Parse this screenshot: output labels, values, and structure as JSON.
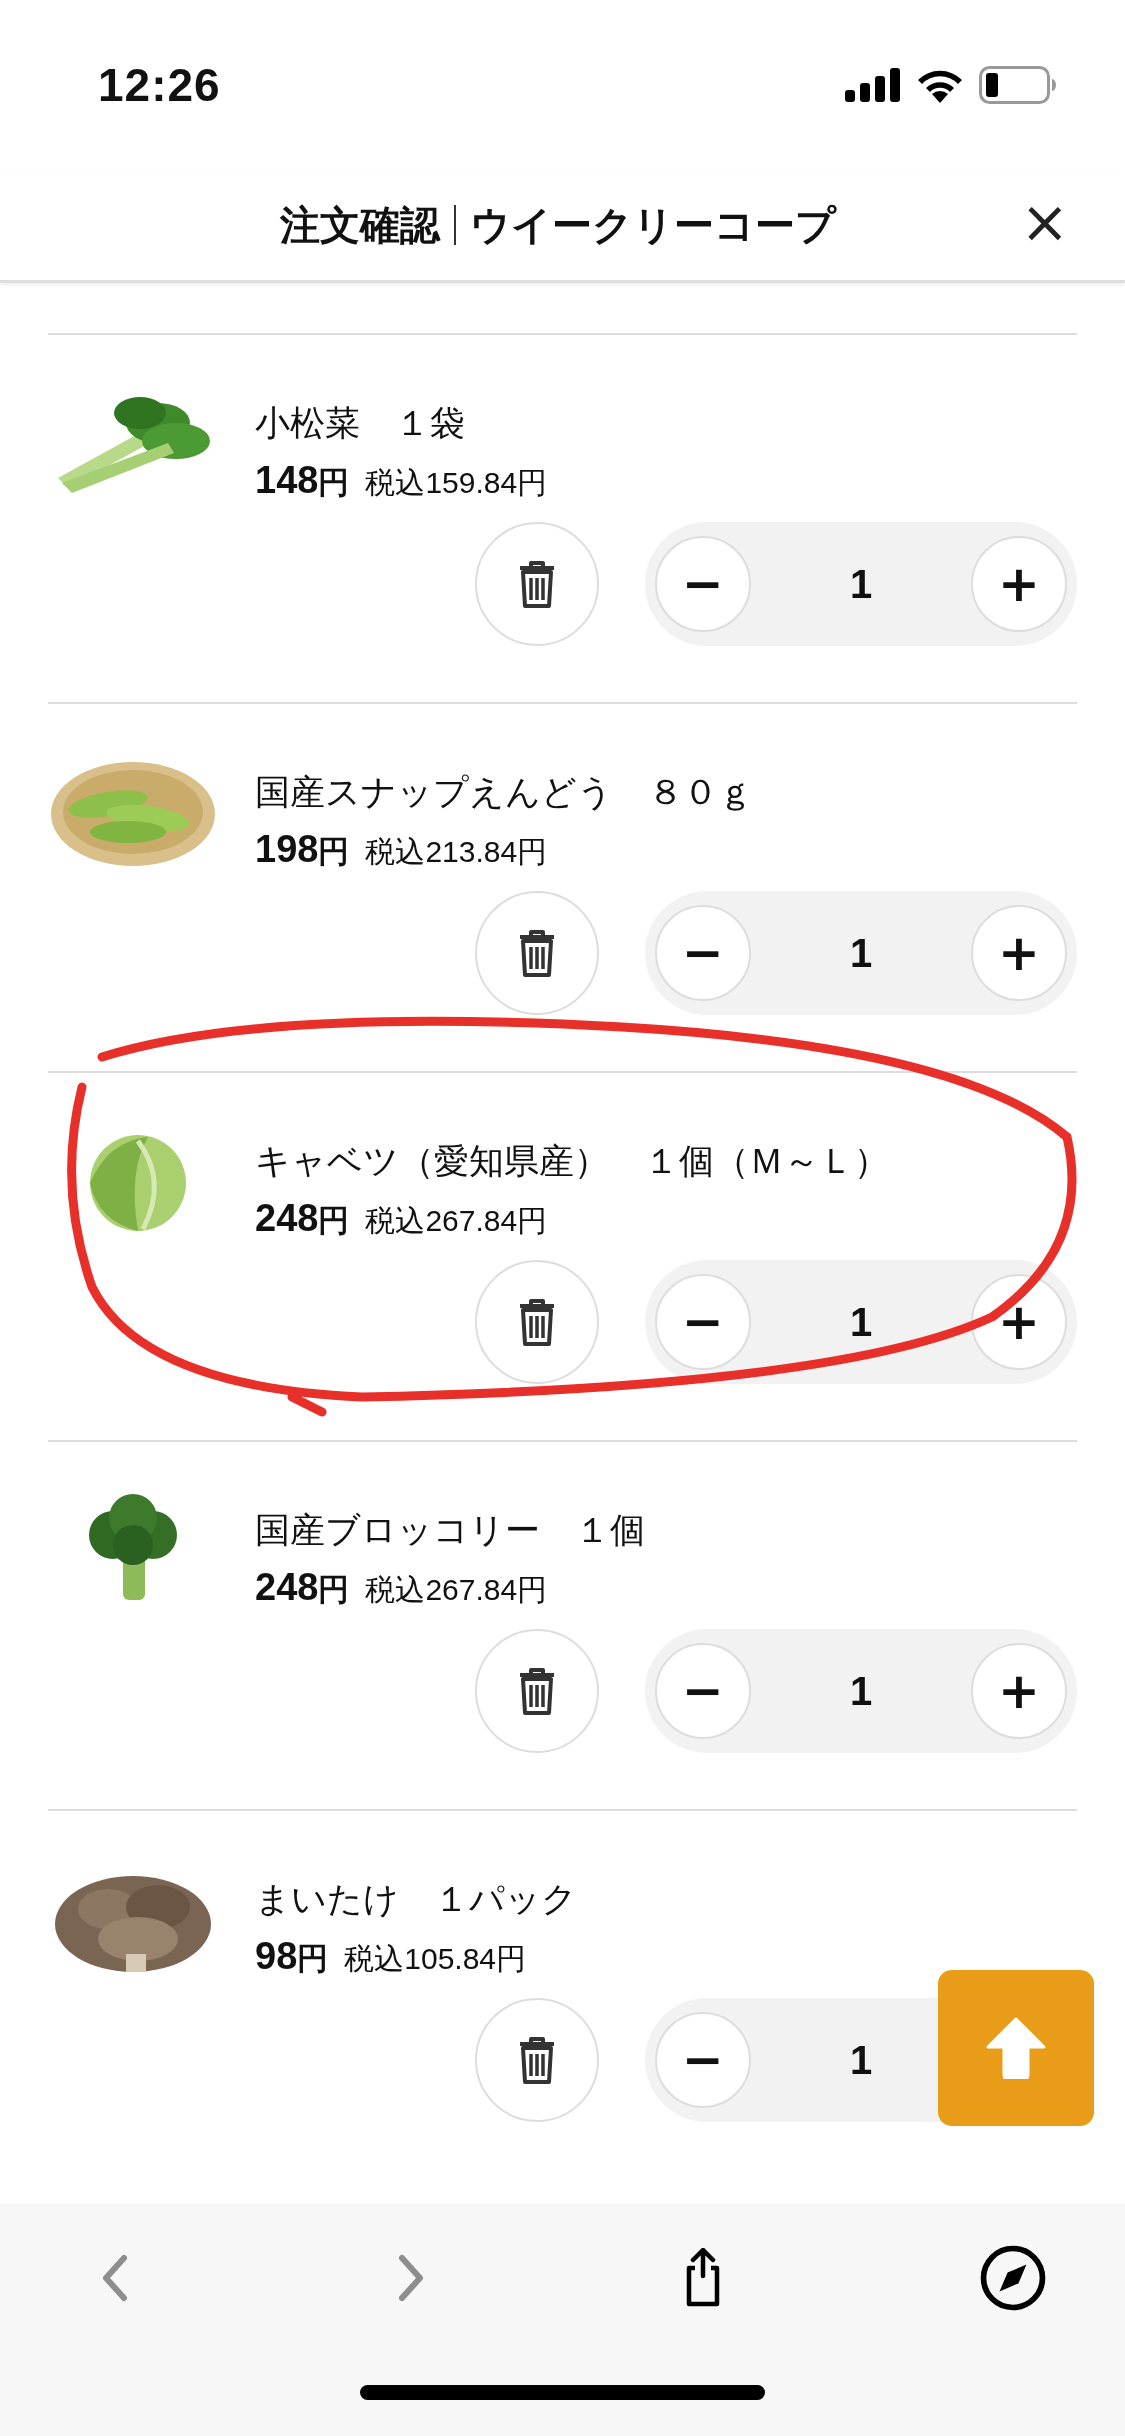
{
  "status_bar": {
    "time": "12:26"
  },
  "header": {
    "title": "注文確認",
    "subtitle": "ウイークリーコープ",
    "close": "×"
  },
  "items": [
    {
      "name": "小松菜　１袋",
      "price": "148",
      "yen": "円",
      "tax_price": "税込159.84円",
      "quantity": "1",
      "minus": "−",
      "plus": "+",
      "highlighted": false
    },
    {
      "name": "国産スナップえんどう　８０ｇ",
      "price": "198",
      "yen": "円",
      "tax_price": "税込213.84円",
      "quantity": "1",
      "minus": "−",
      "plus": "+",
      "highlighted": false
    },
    {
      "name": "キャベツ（愛知県産）　１個（Ｍ～Ｌ）",
      "price": "248",
      "yen": "円",
      "tax_price": "税込267.84円",
      "quantity": "1",
      "minus": "−",
      "plus": "+",
      "highlighted": true
    },
    {
      "name": "国産ブロッコリー　１個",
      "price": "248",
      "yen": "円",
      "tax_price": "税込267.84円",
      "quantity": "1",
      "minus": "−",
      "plus": "+",
      "highlighted": false
    },
    {
      "name": "まいたけ　１パック",
      "price": "98",
      "yen": "円",
      "tax_price": "税込105.84円",
      "quantity": "1",
      "minus": "−",
      "highlighted": false
    }
  ],
  "toolbar": [
    {
      "kind": "back",
      "disabled": true
    },
    {
      "kind": "forward",
      "disabled": true
    },
    {
      "kind": "share",
      "disabled": false
    },
    {
      "kind": "compass",
      "disabled": false
    }
  ]
}
